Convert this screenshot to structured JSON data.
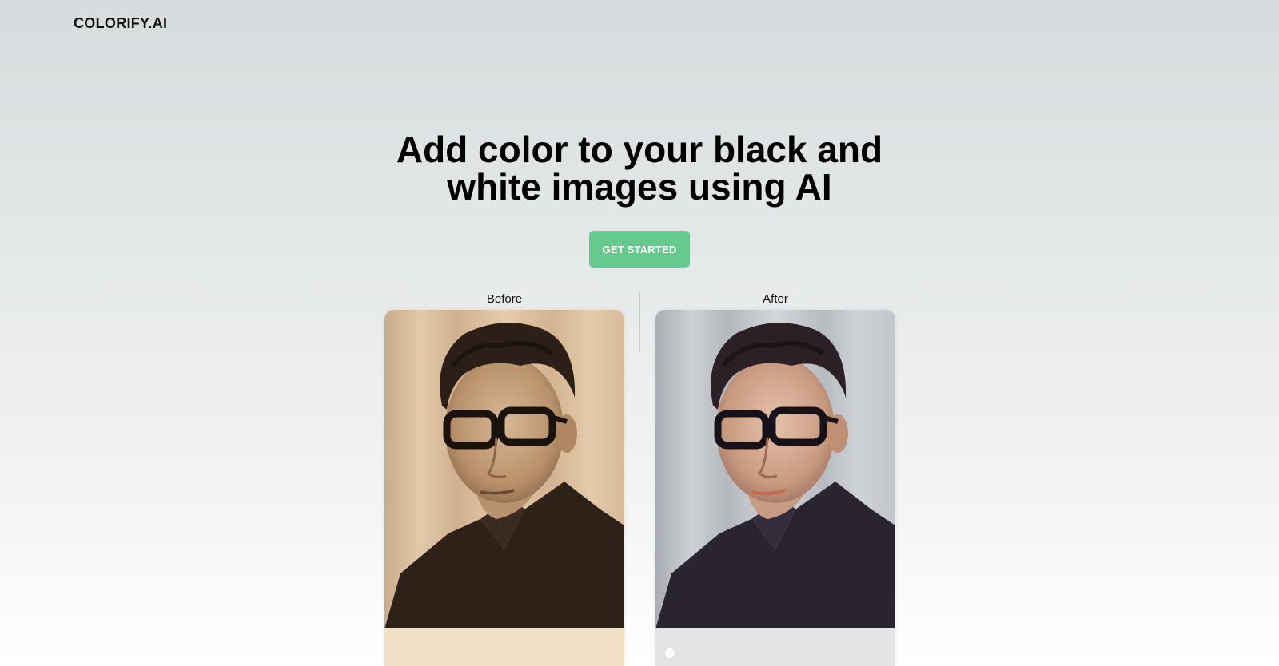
{
  "header": {
    "logo_text": "COLORIFY.AI"
  },
  "hero": {
    "title_line1": "Add color to your black and",
    "title_line2": "white images using AI",
    "cta_label": "GET STARTED"
  },
  "comparison": {
    "before_label": "Before",
    "after_label": "After"
  },
  "colors": {
    "cta_background": "#66c98d",
    "cta_text": "#ffffff",
    "background_top": "#d7dbdd",
    "background_bottom": "#ffffff",
    "before_tone": "#d9bfa0",
    "after_tone": "#c7cace"
  },
  "icons": {
    "before_photo": "portrait-sepia-photo",
    "after_photo": "portrait-colorized-photo"
  }
}
